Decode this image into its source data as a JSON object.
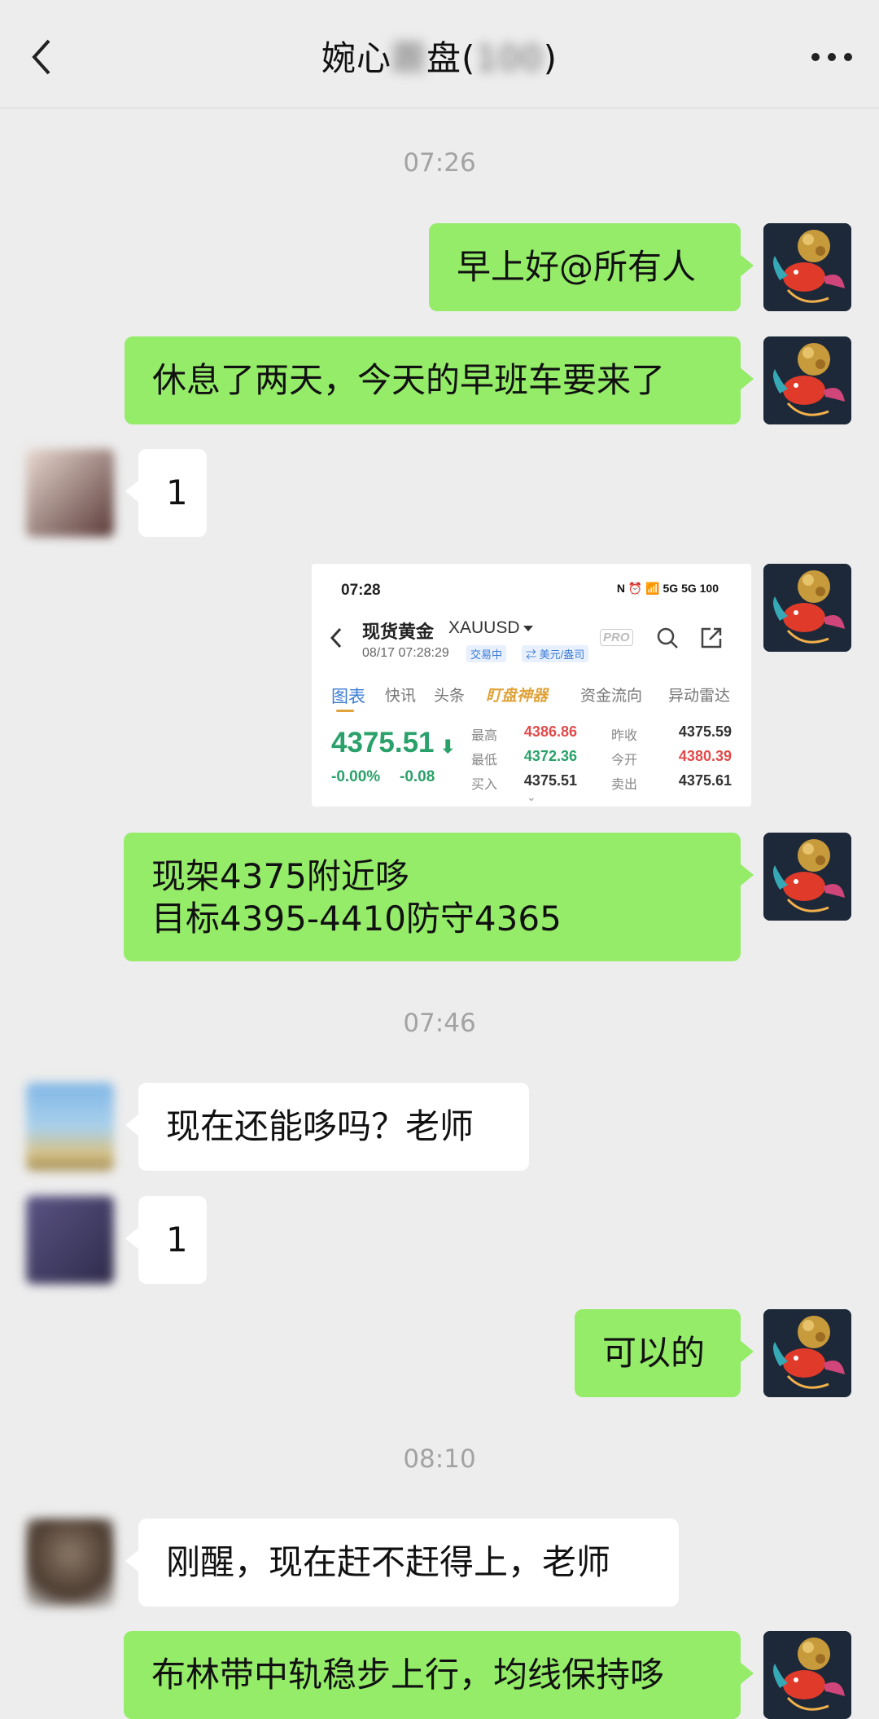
{
  "header": {
    "title_prefix": "婉心",
    "title_blurred_mid": "跟",
    "title_suffix": "盘(",
    "title_blurred_count": "100",
    "title_close": ")"
  },
  "timestamps": [
    "07:26",
    "07:46",
    "08:10"
  ],
  "messages": {
    "m1": "早上好@所有人",
    "m2": "休息了两天，今天的早班车要来了",
    "m3": "1",
    "m5_line1": "现架4375附近哆",
    "m5_line2": "目标4395-4410防守4365",
    "m6": "现在还能哆吗？老师",
    "m7": "1",
    "m8": "可以的",
    "m9": "刚醒，现在赶不赶得上，老师",
    "m10": "布林带中轨稳步上行，均线保持哆"
  },
  "shot": {
    "time": "07:28",
    "status": "N ⏰ 📶 5G 5G 100",
    "name": "现货黄金",
    "code": "XAUUSD",
    "date": "08/17 07:28:29",
    "tag1": "交易中",
    "tag2": "⇄ 美元/盎司",
    "pro": "PRO",
    "tabs": [
      "图表",
      "快讯",
      "头条",
      "盯盘神器",
      "资金流向",
      "异动雷达"
    ],
    "price": "4375.51",
    "arrow": "⬇",
    "chg_pct": "-0.00%",
    "chg_abs": "-0.08",
    "labels": [
      "最高",
      "最低",
      "买入",
      "昨收",
      "今开",
      "卖出"
    ],
    "high": "4386.86",
    "low": "4372.36",
    "bid": "4375.51",
    "prev_close": "4375.59",
    "open": "4380.39",
    "ask": "4375.61",
    "chevron": "⌄"
  }
}
